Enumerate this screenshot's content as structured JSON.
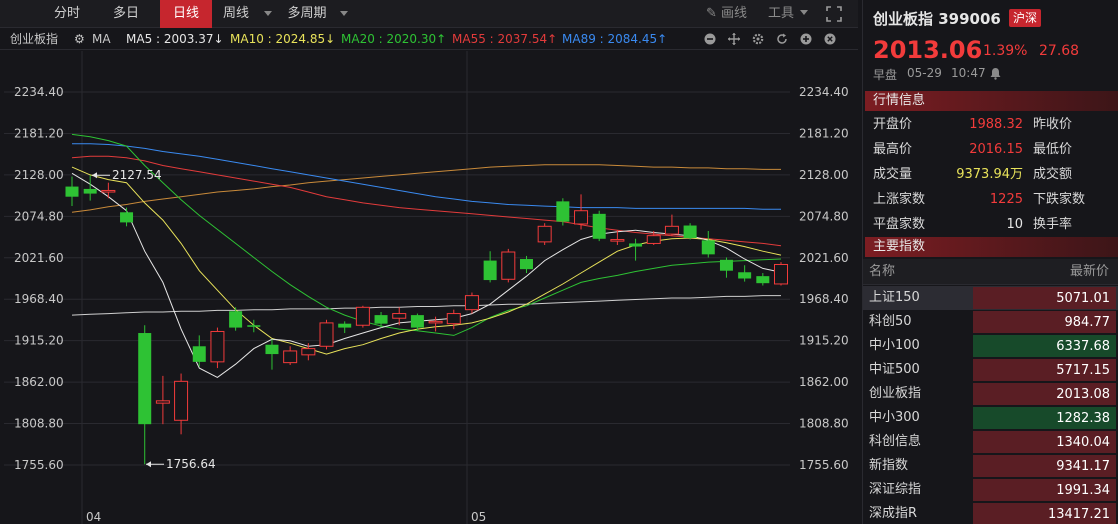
{
  "toolbar": {
    "tabs": [
      {
        "label": "分时"
      },
      {
        "label": "多日"
      },
      {
        "label": "日线"
      },
      {
        "label": "周线"
      },
      {
        "label": "多周期"
      }
    ],
    "draw_label": "画线",
    "tools_label": "工具"
  },
  "ma_row": {
    "index_name": "创业板指",
    "ma_label": "MA",
    "ma5": {
      "text": "MA5 : 2003.37↓",
      "color": "#e6e6e6"
    },
    "ma10": {
      "text": "MA10 : 2024.85↓",
      "color": "#e8e25a"
    },
    "ma20": {
      "text": "MA20 : 2020.30↑",
      "color": "#2ec234"
    },
    "ma55": {
      "text": "MA55 : 2037.54↑",
      "color": "#e23b3b"
    },
    "ma89": {
      "text": "MA89 : 2084.45↑",
      "color": "#3a8af0"
    }
  },
  "chart_data": {
    "type": "candlestick",
    "y_ticks": [
      "2234.40",
      "2181.20",
      "2128.00",
      "2074.80",
      "2021.60",
      "1968.40",
      "1915.20",
      "1862.00",
      "1808.80",
      "1755.60"
    ],
    "x_ticks": [
      "04",
      "05"
    ],
    "ylim": [
      1730,
      2260
    ],
    "annotations": {
      "high": "2127.54",
      "low": "1756.64"
    },
    "candles": [
      {
        "o": 2113,
        "c": 2100,
        "h": 2126,
        "l": 2088
      },
      {
        "o": 2110,
        "c": 2104,
        "h": 2127.54,
        "l": 2095
      },
      {
        "o": 2106,
        "c": 2108,
        "h": 2118,
        "l": 2098
      },
      {
        "o": 2080,
        "c": 2067,
        "h": 2086,
        "l": 2062
      },
      {
        "o": 1925,
        "c": 1808,
        "h": 1935,
        "l": 1756.64
      },
      {
        "o": 1835,
        "c": 1838,
        "h": 1870,
        "l": 1808
      },
      {
        "o": 1813,
        "c": 1863,
        "h": 1873,
        "l": 1795
      },
      {
        "o": 1908,
        "c": 1888,
        "h": 1922,
        "l": 1882
      },
      {
        "o": 1888,
        "c": 1927,
        "h": 1932,
        "l": 1880
      },
      {
        "o": 1953,
        "c": 1932,
        "h": 1958,
        "l": 1928
      },
      {
        "o": 1935,
        "c": 1933,
        "h": 1942,
        "l": 1926
      },
      {
        "o": 1910,
        "c": 1898,
        "h": 1917,
        "l": 1878
      },
      {
        "o": 1887,
        "c": 1902,
        "h": 1908,
        "l": 1884
      },
      {
        "o": 1897,
        "c": 1905,
        "h": 1912,
        "l": 1890
      },
      {
        "o": 1908,
        "c": 1938,
        "h": 1942,
        "l": 1904
      },
      {
        "o": 1937,
        "c": 1932,
        "h": 1940,
        "l": 1925
      },
      {
        "o": 1935,
        "c": 1958,
        "h": 1960,
        "l": 1932
      },
      {
        "o": 1948,
        "c": 1937,
        "h": 1952,
        "l": 1932
      },
      {
        "o": 1944,
        "c": 1950,
        "h": 1958,
        "l": 1935
      },
      {
        "o": 1948,
        "c": 1932,
        "h": 1950,
        "l": 1928
      },
      {
        "o": 1938,
        "c": 1940,
        "h": 1946,
        "l": 1927
      },
      {
        "o": 1937,
        "c": 1950,
        "h": 1955,
        "l": 1930
      },
      {
        "o": 1955,
        "c": 1973,
        "h": 1977,
        "l": 1950
      },
      {
        "o": 2018,
        "c": 1993,
        "h": 2030,
        "l": 1990
      },
      {
        "o": 1994,
        "c": 2029,
        "h": 2033,
        "l": 1990
      },
      {
        "o": 2020,
        "c": 2007,
        "h": 2024,
        "l": 2002
      },
      {
        "o": 2042,
        "c": 2062,
        "h": 2066,
        "l": 2038
      },
      {
        "o": 2094,
        "c": 2068,
        "h": 2098,
        "l": 2063
      },
      {
        "o": 2065,
        "c": 2082,
        "h": 2103,
        "l": 2058
      },
      {
        "o": 2078,
        "c": 2046,
        "h": 2082,
        "l": 2043
      },
      {
        "o": 2043,
        "c": 2045,
        "h": 2057,
        "l": 2038
      },
      {
        "o": 2040,
        "c": 2036,
        "h": 2046,
        "l": 2018
      },
      {
        "o": 2040,
        "c": 2050,
        "h": 2056,
        "l": 2038
      },
      {
        "o": 2052,
        "c": 2062,
        "h": 2077,
        "l": 2050
      },
      {
        "o": 2063,
        "c": 2047,
        "h": 2066,
        "l": 2045
      },
      {
        "o": 2044,
        "c": 2026,
        "h": 2056,
        "l": 2022
      },
      {
        "o": 2019,
        "c": 2005,
        "h": 2022,
        "l": 1996
      },
      {
        "o": 2003,
        "c": 1995,
        "h": 2012,
        "l": 1991
      },
      {
        "o": 1998,
        "c": 1989,
        "h": 2002,
        "l": 1986
      },
      {
        "o": 1988,
        "c": 2013,
        "h": 2016,
        "l": 1986
      }
    ],
    "ma5": [
      2130,
      2116,
      2100,
      2082,
      2030,
      1990,
      1930,
      1880,
      1868,
      1885,
      1905,
      1917,
      1915,
      1908,
      1910,
      1918,
      1925,
      1932,
      1938,
      1940,
      1942,
      1944,
      1950,
      1962,
      1980,
      1998,
      2018,
      2032,
      2045,
      2052,
      2055,
      2057,
      2054,
      2052,
      2050,
      2044,
      2034,
      2020,
      2008,
      2003
    ],
    "ma10": [
      2138,
      2128,
      2122,
      2118,
      2092,
      2070,
      2040,
      2005,
      1980,
      1955,
      1935,
      1918,
      1912,
      1905,
      1898,
      1905,
      1910,
      1918,
      1925,
      1930,
      1933,
      1935,
      1938,
      1944,
      1952,
      1962,
      1975,
      1988,
      2002,
      2016,
      2030,
      2038,
      2043,
      2046,
      2047,
      2045,
      2041,
      2036,
      2030,
      2025
    ],
    "ma20": [
      2180,
      2177,
      2172,
      2165,
      2140,
      2118,
      2096,
      2076,
      2058,
      2040,
      2022,
      2004,
      1987,
      1972,
      1958,
      1948,
      1940,
      1934,
      1930,
      1928,
      1925,
      1922,
      1932,
      1945,
      1954,
      1960,
      1970,
      1980,
      1990,
      1995,
      1999,
      2004,
      2008,
      2012,
      2014,
      2016,
      2017,
      2018,
      2019,
      2020
    ],
    "ma55": [
      2150,
      2152,
      2152,
      2150,
      2146,
      2140,
      2136,
      2132,
      2128,
      2124,
      2120,
      2116,
      2112,
      2106,
      2100,
      2096,
      2092,
      2089,
      2086,
      2084,
      2082,
      2080,
      2078,
      2076,
      2074,
      2072,
      2070,
      2068,
      2064,
      2060,
      2057,
      2054,
      2052,
      2050,
      2048,
      2046,
      2044,
      2042,
      2040,
      2037
    ],
    "ma89": [
      2168,
      2168,
      2167,
      2165,
      2162,
      2158,
      2155,
      2152,
      2148,
      2144,
      2140,
      2136,
      2132,
      2128,
      2124,
      2120,
      2116,
      2112,
      2108,
      2104,
      2100,
      2097,
      2094,
      2092,
      2090,
      2089,
      2088,
      2087,
      2086,
      2086,
      2086,
      2085,
      2085,
      2085,
      2085,
      2085,
      2085,
      2085,
      2084,
      2084
    ],
    "ma_long_orange": [
      2080,
      2083,
      2087,
      2090,
      2094,
      2097,
      2100,
      2103,
      2106,
      2108,
      2110,
      2113,
      2115,
      2118,
      2120,
      2122,
      2124,
      2126,
      2128,
      2130,
      2132,
      2134,
      2136,
      2138,
      2139,
      2140,
      2141,
      2141,
      2141,
      2141,
      2140,
      2139,
      2138,
      2138,
      2137,
      2137,
      2136,
      2136,
      2135,
      2135
    ],
    "ma_long_gray": [
      1948,
      1949,
      1950,
      1951,
      1952,
      1952,
      1953,
      1953,
      1954,
      1954,
      1955,
      1955,
      1956,
      1956,
      1956,
      1957,
      1957,
      1958,
      1958,
      1959,
      1959,
      1960,
      1960,
      1961,
      1962,
      1962,
      1963,
      1964,
      1965,
      1966,
      1967,
      1968,
      1969,
      1970,
      1970,
      1971,
      1972,
      1972,
      1973,
      1973
    ]
  },
  "panel": {
    "title": "创业板指 399006",
    "badge": "沪深",
    "price": "2013.06",
    "pct": "1.39%",
    "change": "27.68",
    "session": "早盘",
    "date": "05-29",
    "time": "10:47",
    "quote_section": "行情信息",
    "quotes": [
      {
        "label": "开盘价",
        "value": "1988.32",
        "label2": "昨收价",
        "color": "#f23b3b"
      },
      {
        "label": "最高价",
        "value": "2016.15",
        "label2": "最低价",
        "color": "#f23b3b"
      },
      {
        "label": "成交量",
        "value": "9373.94万",
        "label2": "成交额",
        "color": "#e8e25a"
      },
      {
        "label": "上涨家数",
        "value": "1225",
        "label2": "下跌家数",
        "color": "#f23b3b"
      },
      {
        "label": "平盘家数",
        "value": "10",
        "label2": "换手率",
        "color": "#e6e6e6"
      }
    ],
    "index_section": "主要指数",
    "index_col_name": "名称",
    "index_col_price": "最新价",
    "indices": [
      {
        "name": "上证150",
        "value": "5071.01",
        "color": "#5a1e24"
      },
      {
        "name": "科创50",
        "value": "984.77",
        "color": "#5a1e24"
      },
      {
        "name": "中小100",
        "value": "6337.68",
        "color": "#174a2a"
      },
      {
        "name": "中证500",
        "value": "5717.15",
        "color": "#5a1e24"
      },
      {
        "name": "创业板指",
        "value": "2013.08",
        "color": "#5a1e24"
      },
      {
        "name": "中小300",
        "value": "1282.38",
        "color": "#174a2a"
      },
      {
        "name": "科创信息",
        "value": "1340.04",
        "color": "#5a1e24"
      },
      {
        "name": "新指数",
        "value": "9341.17",
        "color": "#5a1e24"
      },
      {
        "name": "深证综指",
        "value": "1991.34",
        "color": "#5a1e24"
      },
      {
        "name": "深成指R",
        "value": "13417.21",
        "color": "#5a1e24"
      }
    ]
  }
}
